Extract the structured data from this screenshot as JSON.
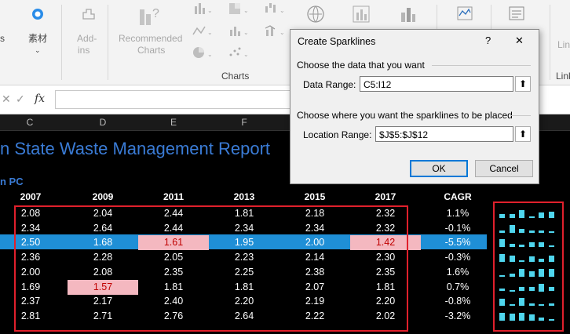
{
  "ribbon": {
    "left_label": "s",
    "material_label": "素材",
    "addins_label": "Add-",
    "addins_label2": "ins",
    "recommended_label": "Recommended",
    "charts_label": "Charts",
    "group_charts": "Charts",
    "right_label_top": "Lin",
    "right_label_bottom": "Link"
  },
  "formula_bar": {
    "fx": "fx",
    "cancel": "✕",
    "enter": "✓"
  },
  "columns": [
    "C",
    "D",
    "E",
    "F",
    "G",
    "H",
    "I"
  ],
  "sheet": {
    "title": "n State Waste Management Report",
    "subtitle": "n PC",
    "years": [
      "2007",
      "2009",
      "2011",
      "2013",
      "2015",
      "2017"
    ],
    "cagr_header": "CAGR",
    "rows": [
      {
        "v": [
          "2.08",
          "2.04",
          "2.44",
          "1.81",
          "2.18",
          "2.32"
        ],
        "cagr": "1.1%"
      },
      {
        "v": [
          "2.34",
          "2.64",
          "2.44",
          "2.34",
          "2.34",
          "2.32"
        ],
        "cagr": "-0.1%"
      },
      {
        "v": [
          "2.50",
          "1.68",
          "1.61",
          "1.95",
          "2.00",
          "1.42"
        ],
        "cagr": "-5.5%"
      },
      {
        "v": [
          "2.36",
          "2.28",
          "2.05",
          "2.23",
          "2.14",
          "2.30"
        ],
        "cagr": "-0.3%"
      },
      {
        "v": [
          "2.00",
          "2.08",
          "2.35",
          "2.25",
          "2.38",
          "2.35"
        ],
        "cagr": "1.6%"
      },
      {
        "v": [
          "1.69",
          "1.57",
          "1.81",
          "1.81",
          "2.07",
          "1.81"
        ],
        "cagr": "0.7%"
      },
      {
        "v": [
          "2.37",
          "2.17",
          "2.40",
          "2.20",
          "2.19",
          "2.20"
        ],
        "cagr": "-0.8%"
      },
      {
        "v": [
          "2.81",
          "2.71",
          "2.76",
          "2.64",
          "2.22",
          "2.02"
        ],
        "cagr": "-3.2%"
      }
    ]
  },
  "colors": {
    "selection": "#1f8fd6",
    "highlight_bg": "#f4b8c0",
    "highlight_text": "#c00000",
    "sparkline": "#4fd6ee",
    "box": "#e0202c"
  },
  "dialog": {
    "title": "Create Sparklines",
    "help": "?",
    "close": "✕",
    "section1": "Choose the data that you want",
    "data_range_label": "Data Range:",
    "data_range_value": "C5:I12",
    "section2": "Choose where you want the sparklines to be placed",
    "location_label": "Location Range:",
    "location_value": "$J$5:$J$12",
    "ok": "OK",
    "cancel": "Cancel"
  }
}
